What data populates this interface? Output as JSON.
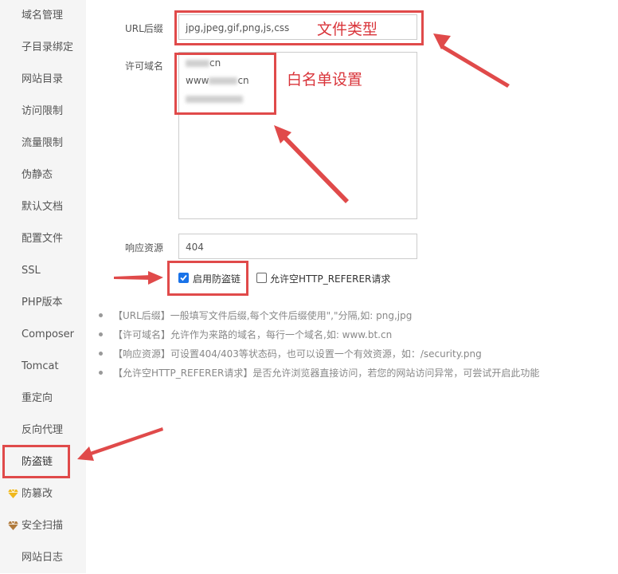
{
  "sidebar": {
    "items": [
      {
        "label": "域名管理"
      },
      {
        "label": "子目录绑定"
      },
      {
        "label": "网站目录"
      },
      {
        "label": "访问限制"
      },
      {
        "label": "流量限制"
      },
      {
        "label": "伪静态"
      },
      {
        "label": "默认文档"
      },
      {
        "label": "配置文件"
      },
      {
        "label": "SSL"
      },
      {
        "label": "PHP版本"
      },
      {
        "label": "Composer"
      },
      {
        "label": "Tomcat"
      },
      {
        "label": "重定向"
      },
      {
        "label": "反向代理"
      },
      {
        "label": "防盗链",
        "active": true
      },
      {
        "label": "防篡改",
        "icon": "gem-icon",
        "icon_color": "#f0b81c"
      },
      {
        "label": "安全扫描",
        "icon": "gem-icon",
        "icon_color": "#b07a3c"
      },
      {
        "label": "网站日志"
      }
    ]
  },
  "form": {
    "url_suffix": {
      "label": "URL后缀",
      "value": "jpg,jpeg,gif,png,js,css"
    },
    "allowed_domains": {
      "label": "许可域名",
      "lines": [
        {
          "prefix": "",
          "suffix": "cn"
        },
        {
          "prefix": "www",
          "suffix": "cn"
        },
        {
          "prefix": "",
          "suffix": ""
        }
      ]
    },
    "response": {
      "label": "响应资源",
      "value": "404"
    },
    "enable_hotlink": {
      "label": "启用防盗链",
      "checked": true
    },
    "allow_empty_referer": {
      "label": "允许空HTTP_REFERER请求",
      "checked": false
    }
  },
  "annotations": {
    "file_type": "文件类型",
    "whitelist": "白名单设置"
  },
  "notes": [
    "【URL后缀】一般填写文件后缀,每个文件后缀使用\",\"分隔,如: png,jpg",
    "【许可域名】允许作为来路的域名，每行一个域名,如: www.bt.cn",
    "【响应资源】可设置404/403等状态码，也可以设置一个有效资源，如：/security.png",
    "【允许空HTTP_REFERER请求】是否允许浏览器直接访问，若您的网站访问异常，可尝试开启此功能"
  ],
  "colors": {
    "annotation_red": "#e04a4a",
    "checkbox_blue": "#1a73e8"
  }
}
